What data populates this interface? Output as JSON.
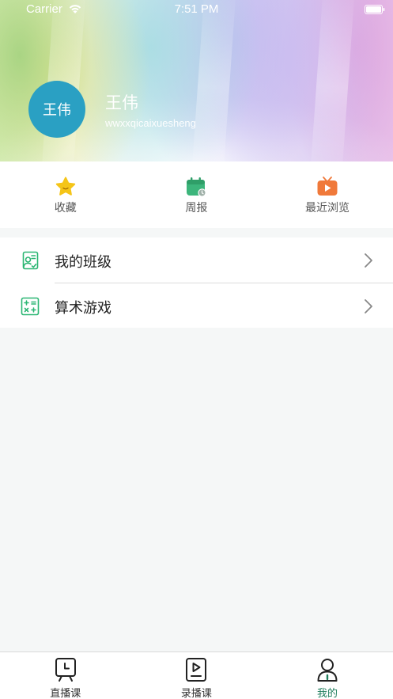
{
  "status_bar": {
    "carrier": "Carrier",
    "time": "7:51 PM"
  },
  "profile": {
    "avatar_text": "王伟",
    "name": "王伟",
    "username": "wwxxqicaixuesheng"
  },
  "quick_actions": [
    {
      "label": "收藏",
      "icon": "star-icon"
    },
    {
      "label": "周报",
      "icon": "calendar-icon"
    },
    {
      "label": "最近浏览",
      "icon": "tv-play-icon"
    }
  ],
  "menu": [
    {
      "label": "我的班级",
      "icon": "class-icon"
    },
    {
      "label": "算术游戏",
      "icon": "calculator-icon"
    }
  ],
  "tabs": [
    {
      "label": "直播课",
      "icon": "live-class-icon",
      "active": false
    },
    {
      "label": "录播课",
      "icon": "recorded-class-icon",
      "active": false
    },
    {
      "label": "我的",
      "icon": "profile-icon",
      "active": true
    }
  ],
  "colors": {
    "accent": "#1f7d5c",
    "avatar": "#2aa0c3",
    "star": "#f5c518",
    "calendar": "#3cb57b",
    "tv": "#f0793a",
    "menu_icon": "#2bb673"
  }
}
